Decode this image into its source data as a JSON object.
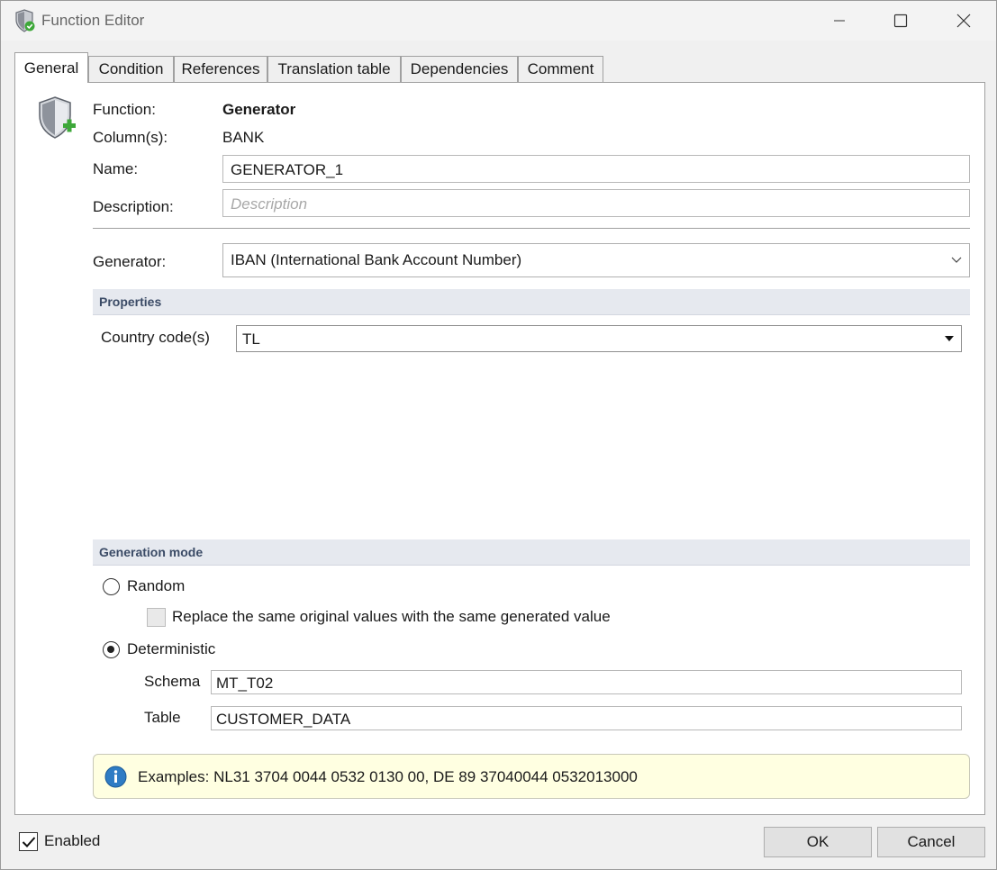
{
  "window": {
    "title": "Function Editor"
  },
  "tabs": [
    {
      "label": "General",
      "active": true
    },
    {
      "label": "Condition",
      "active": false
    },
    {
      "label": "References",
      "active": false
    },
    {
      "label": "Translation table",
      "active": false
    },
    {
      "label": "Dependencies",
      "active": false
    },
    {
      "label": "Comment",
      "active": false
    }
  ],
  "general": {
    "function_label": "Function:",
    "function_value": "Generator",
    "columns_label": "Column(s):",
    "columns_value": "BANK",
    "name_label": "Name:",
    "name_value": "GENERATOR_1",
    "description_label": "Description:",
    "description_placeholder": "Description",
    "generator_label": "Generator:",
    "generator_value": "IBAN (International Bank Account Number)"
  },
  "properties": {
    "header": "Properties",
    "country_code_label": "Country code(s)",
    "country_code_value": "TL"
  },
  "generation_mode": {
    "header": "Generation mode",
    "random_label": "Random",
    "random_selected": false,
    "replace_label": "Replace the same original values with the same generated value",
    "replace_checked": false,
    "deterministic_label": "Deterministic",
    "deterministic_selected": true,
    "schema_label": "Schema",
    "schema_value": "MT_T02",
    "table_label": "Table",
    "table_value": "CUSTOMER_DATA"
  },
  "info": {
    "text": "Examples: NL31 3704 0044 0532 0130 00, DE 89 37040044 0532013000"
  },
  "footer": {
    "enabled_label": "Enabled",
    "enabled_checked": true,
    "ok_label": "OK",
    "cancel_label": "Cancel"
  },
  "colors": {
    "section_header_bg": "#e6e9ef",
    "section_header_text": "#3b4b66",
    "info_bg": "#ffffe1",
    "info_icon": "#2f7cc4",
    "shield_plus": "#3ea83a"
  }
}
